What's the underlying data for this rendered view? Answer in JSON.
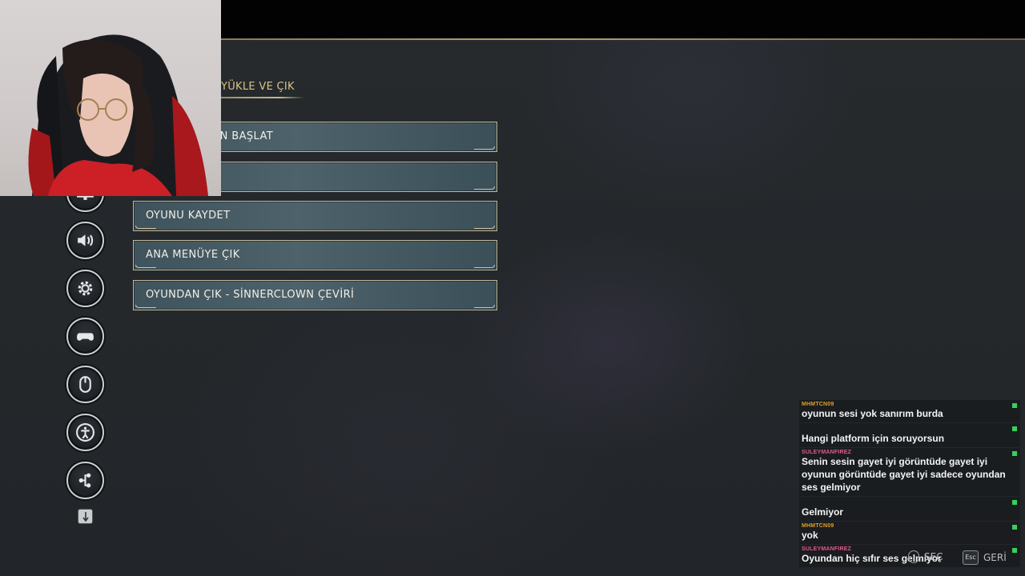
{
  "header": {
    "section_title": "YÜKLE VE ÇIK"
  },
  "menu": {
    "items": [
      {
        "label": "EDEN YENİDEN BAŞLAT"
      },
      {
        "label": ""
      },
      {
        "label": "OYUNU KAYDET"
      },
      {
        "label": "ANA MENÜYE ÇIK"
      },
      {
        "label": "OYUNDAN ÇIK - SİNNERCLOWN ÇEVİRİ"
      }
    ]
  },
  "nav_icons": [
    "display-icon",
    "speaker-icon",
    "gear-icon",
    "gamepad-icon",
    "mouse-icon",
    "accessibility-icon",
    "share-icon"
  ],
  "chat": {
    "messages": [
      {
        "user": "MHMTCN09",
        "user_color": "#e0a020",
        "text": "oyunun sesi yok sanırım burda"
      },
      {
        "user": "",
        "user_color": "#d93030",
        "text": "Hangi platform için soruyorsun"
      },
      {
        "user": "SULEYMANFIREZ",
        "user_color": "#e05a8a",
        "text": "Senin sesin gayet iyi görüntüde gayet iyi oyunun görüntüde gayet iyi sadece oyundan ses gelmiyor"
      },
      {
        "user": "",
        "user_color": "#d93030",
        "text": "Gelmiyor"
      },
      {
        "user": "MHMTCN09",
        "user_color": "#e0a020",
        "text": "yok"
      },
      {
        "user": "SULEYMANFIREZ",
        "user_color": "#e05a8a",
        "text": "Oyundan hiç sıfır ses gelmiyor"
      }
    ]
  },
  "footer": {
    "select_label": "SEÇ",
    "back_key": "Esc",
    "back_label": "GERİ"
  },
  "colors": {
    "accent_gold": "#d8c387",
    "button_border": "#c4b99a",
    "chat_mark": "#37d05a"
  }
}
